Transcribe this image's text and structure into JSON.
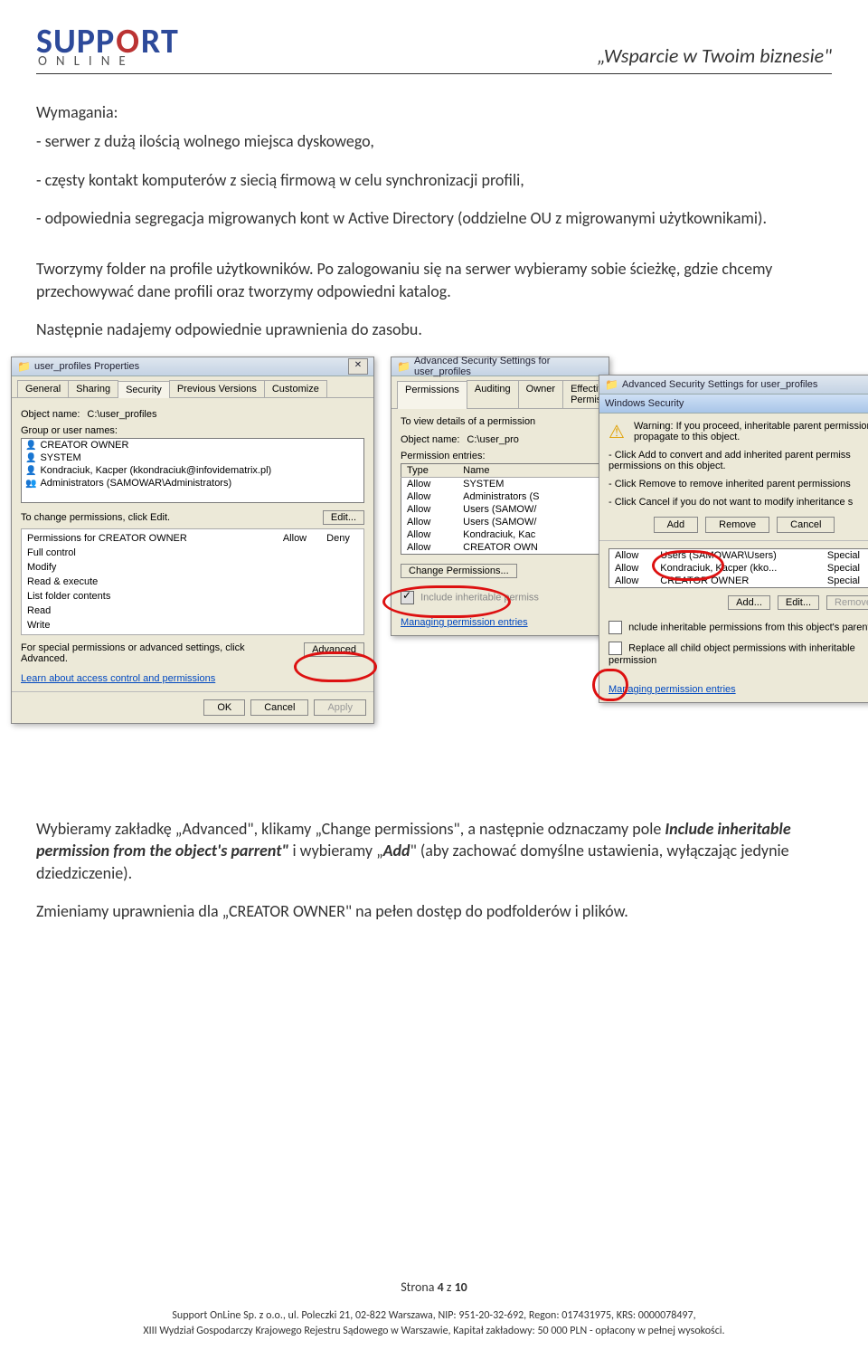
{
  "header": {
    "logo_main_1": "SUPP",
    "logo_main_o": "O",
    "logo_main_2": "RT",
    "logo_sub": "ONLINE",
    "tagline": "„Wsparcie w Twoim biznesie\""
  },
  "body": {
    "req_title": "Wymagania:",
    "req1": "- serwer z dużą ilością wolnego miejsca dyskowego,",
    "req2": "- częsty kontakt komputerów z siecią firmową w celu synchronizacji profili,",
    "req3": "- odpowiednia segregacja migrowanych kont w Active Directory (oddzielne OU z migrowanymi użytkownikami).",
    "p1": "Tworzymy folder na profile użytkowników. Po zalogowaniu się na serwer wybieramy sobie ścieżkę, gdzie chcemy przechowywać dane profili oraz tworzymy odpowiedni katalog.",
    "p2": "Następnie nadajemy odpowiednie uprawnienia do zasobu.",
    "after1": "Wybieramy zakładkę „Advanced\", klikamy „Change permissions\", a następnie odznaczamy pole ",
    "after1_i": "Include inheritable permission from the object's parrent\"",
    "after1_mid": " i wybieramy „",
    "after1_b": "Add",
    "after1_end": "\" (aby zachować domyślne ustawienia, wyłączając jedynie dziedziczenie).",
    "after2": "Zmieniamy uprawnienia dla „CREATOR OWNER\" na pełen dostęp do podfolderów i plików."
  },
  "win1": {
    "title": "user_profiles Properties",
    "tabs": [
      "General",
      "Sharing",
      "Security",
      "Previous Versions",
      "Customize"
    ],
    "object_label": "Object name:",
    "object_val": "C:\\user_profiles",
    "group_label": "Group or user names:",
    "users": [
      {
        "icon": "user",
        "name": "CREATOR OWNER"
      },
      {
        "icon": "user",
        "name": "SYSTEM"
      },
      {
        "icon": "user",
        "name": "Kondraciuk, Kacper (kkondraciuk@infovidematrix.pl)"
      },
      {
        "icon": "users",
        "name": "Administrators (SAMOWAR\\Administrators)"
      }
    ],
    "change_hint": "To change permissions, click Edit.",
    "edit_btn": "Edit...",
    "perm_for": "Permissions for CREATOR OWNER",
    "allow": "Allow",
    "deny": "Deny",
    "rows": [
      "Full control",
      "Modify",
      "Read & execute",
      "List folder contents",
      "Read",
      "Write"
    ],
    "special": "For special permissions or advanced settings, click Advanced.",
    "adv_btn": "Advanced",
    "learn": "Learn about access control and permissions",
    "ok": "OK",
    "cancel": "Cancel",
    "apply": "Apply"
  },
  "win2": {
    "title": "Advanced Security Settings for user_profiles",
    "tabs": [
      "Permissions",
      "Auditing",
      "Owner",
      "Effective Permissions"
    ],
    "desc": "To view details of a permission",
    "object_label": "Object name:",
    "object_val": "C:\\user_pro",
    "entries_label": "Permission entries:",
    "th_type": "Type",
    "th_name": "Name",
    "rows": [
      [
        "Allow",
        "SYSTEM"
      ],
      [
        "Allow",
        "Administrators (S"
      ],
      [
        "Allow",
        "Users (SAMOW/"
      ],
      [
        "Allow",
        "Users (SAMOW/"
      ],
      [
        "Allow",
        "Kondraciuk, Kac"
      ],
      [
        "Allow",
        "CREATOR OWN"
      ]
    ],
    "change_btn": "Change Permissions...",
    "include": "Include inheritable permiss",
    "link": "Managing permission entries"
  },
  "win3": {
    "title": "Advanced Security Settings for user_profiles",
    "sec_title": "Windows Security",
    "warn_p1": "Warning: If you proceed, inheritable parent permissions propagate to this object.",
    "warn_p2": "- Click Add to convert and add inherited parent permiss permissions on this object.",
    "warn_p3": "- Click Remove to remove inherited parent permissions",
    "warn_p4": "- Click Cancel if you do not want to modify inheritance s",
    "add": "Add",
    "remove": "Remove",
    "cancel": "Cancel",
    "under_rows": [
      [
        "Allow",
        "Users (SAMOWAR\\Users)",
        "Special"
      ],
      [
        "Allow",
        "Kondraciuk, Kacper (kko...",
        "Special"
      ],
      [
        "Allow",
        "CREATOR OWNER",
        "Special"
      ]
    ],
    "add2": "Add...",
    "edit": "Edit...",
    "remove2": "Remove",
    "inc1": "nclude inheritable permissions from this object's parent",
    "inc2": "Replace all child object permissions with inheritable permission",
    "link": "Managing permission entries"
  },
  "footer": {
    "page": "Strona 4 z 10",
    "l1": "Support OnLine Sp. z o.o., ul. Poleczki 21, 02-822 Warszawa, NIP: 951-20-32-692, Regon: 017431975, KRS: 0000078497,",
    "l2": "XIII Wydział Gospodarczy Krajowego Rejestru Sądowego w Warszawie, Kapitał zakładowy: 50 000 PLN - opłacony w pełnej wysokości."
  }
}
